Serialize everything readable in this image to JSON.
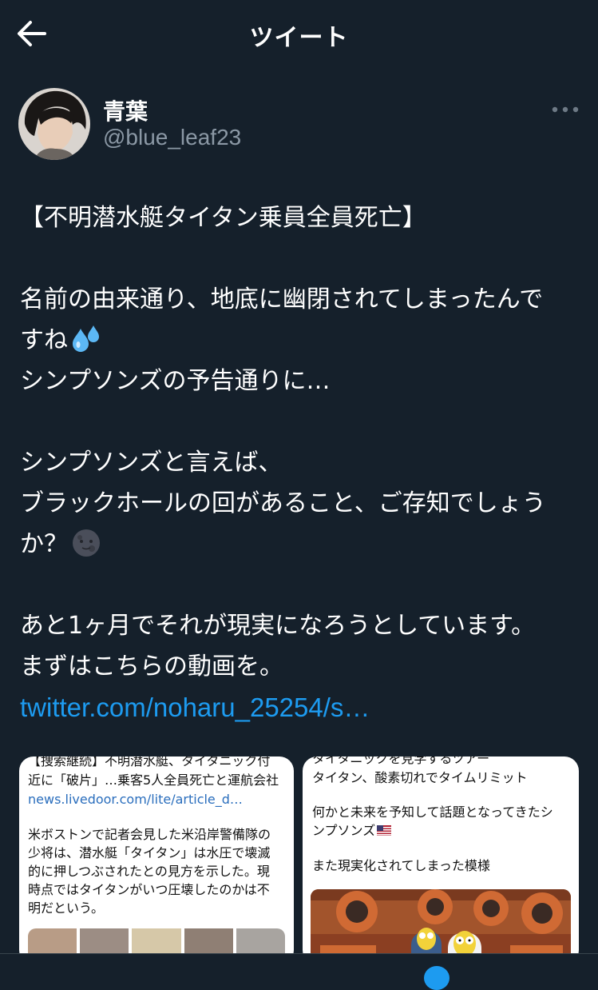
{
  "header": {
    "title": "ツイート",
    "back_icon": "arrow-left-icon"
  },
  "author": {
    "display_name": "青葉",
    "handle": "@blue_leaf23",
    "more_icon": "more-horizontal-icon"
  },
  "tweet": {
    "lines": [
      "【不明潜水艇タイタン乗員全員死亡】",
      "",
      "名前の由来通り、地底に幽閉されてしまったんで",
      "すね",
      "シンプソンズの予告通りに…",
      "",
      "シンプソンズと言えば、",
      "ブラックホールの回があること、ご存知でしょう",
      "か？",
      "",
      "あと1ヶ月でそれが現実になろうとしています。",
      "まずはこちらの動画を。"
    ],
    "emoji_sweat": "sweat-droplets-emoji",
    "emoji_moon": "new-moon-face-emoji",
    "link": "twitter.com/noharu_25254/s…"
  },
  "media": {
    "card1": {
      "headline_1": "【捜索継続】不明潜水艇、タイタニック付",
      "headline_2": "近に「破片」…乗客5人全員死亡と運航会社",
      "url": "news.livedoor.com/lite/article_d…",
      "body_1": "米ボストンで記者会見した米沿岸警備隊の",
      "body_2": "少将は、潜水艇「タイタン」は水圧で壊滅",
      "body_3": "的に押しつぶされたとの見方を示した。現",
      "body_4": "時点ではタイタンがいつ圧壊したのかは不",
      "body_5": "明だという。"
    },
    "card2": {
      "line_0": "タイタニックを見学するツアー",
      "line_1": "タイタン、酸素切れでタイムリミット",
      "line_2": "何かと未来を予知して話題となってきたシ",
      "line_3": "ンプソンズ",
      "line_4": "また現実化されてしまった模様"
    }
  },
  "colors": {
    "background": "#15202b",
    "accent": "#1d9bf0",
    "secondary_text": "#8b98a5"
  }
}
